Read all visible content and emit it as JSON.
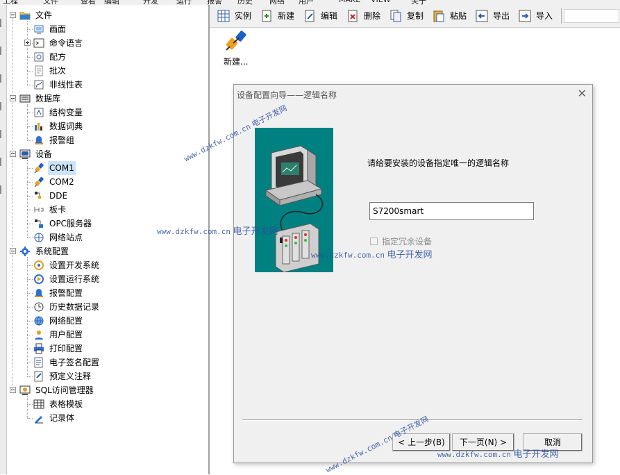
{
  "menu": [
    "工程",
    "文件",
    "查看",
    "编辑",
    "开发",
    "运行",
    "报警",
    "历史",
    "网络",
    "用户",
    "MAKE",
    "VIEW",
    "关于"
  ],
  "tree": {
    "nodes": [
      {
        "id": "file",
        "label": "文件",
        "level": 0,
        "expander": "minus",
        "icon": "folder-icon"
      },
      {
        "id": "screen",
        "label": "画面",
        "level": 1,
        "icon": "screen-icon"
      },
      {
        "id": "cmd",
        "label": "命令语言",
        "level": 1,
        "expander": "plus",
        "icon": "command-icon"
      },
      {
        "id": "recipe",
        "label": "配方",
        "level": 1,
        "icon": "recipe-icon"
      },
      {
        "id": "batch",
        "label": "批次",
        "level": 1,
        "icon": "batch-icon"
      },
      {
        "id": "nonlinear",
        "label": "非线性表",
        "level": 1,
        "icon": "nonlinear-table-icon"
      },
      {
        "id": "db",
        "label": "数据库",
        "level": 0,
        "expander": "minus",
        "icon": "database-icon"
      },
      {
        "id": "struct",
        "label": "结构变量",
        "level": 1,
        "icon": "struct-var-icon"
      },
      {
        "id": "dict",
        "label": "数据词典",
        "level": 1,
        "icon": "data-dictionary-icon"
      },
      {
        "id": "alarmgrp",
        "label": "报警组",
        "level": 1,
        "icon": "alarm-group-icon"
      },
      {
        "id": "device",
        "label": "设备",
        "level": 0,
        "expander": "minus",
        "icon": "device-icon"
      },
      {
        "id": "com1",
        "label": "COM1",
        "level": 1,
        "icon": "plug-icon",
        "selected": true
      },
      {
        "id": "com2",
        "label": "COM2",
        "level": 1,
        "icon": "plug-icon"
      },
      {
        "id": "dde",
        "label": "DDE",
        "level": 1,
        "icon": "dde-icon"
      },
      {
        "id": "board",
        "label": "板卡",
        "level": 1,
        "icon": "board-icon"
      },
      {
        "id": "opc",
        "label": "OPC服务器",
        "level": 1,
        "icon": "opc-icon"
      },
      {
        "id": "netsite",
        "label": "网络站点",
        "level": 1,
        "icon": "network-site-icon"
      },
      {
        "id": "sysconf",
        "label": "系统配置",
        "level": 0,
        "expander": "minus",
        "icon": "gear-icon"
      },
      {
        "id": "devsys",
        "label": "设置开发系统",
        "level": 1,
        "icon": "dev-system-icon"
      },
      {
        "id": "runsys",
        "label": "设置运行系统",
        "level": 1,
        "icon": "run-system-icon"
      },
      {
        "id": "alarmconf",
        "label": "报警配置",
        "level": 1,
        "icon": "alarm-config-icon"
      },
      {
        "id": "history",
        "label": "历史数据记录",
        "level": 1,
        "icon": "history-icon"
      },
      {
        "id": "netconf",
        "label": "网络配置",
        "level": 1,
        "icon": "globe-icon"
      },
      {
        "id": "userconf",
        "label": "用户配置",
        "level": 1,
        "icon": "user-icon"
      },
      {
        "id": "print",
        "label": "打印配置",
        "level": 1,
        "icon": "printer-icon"
      },
      {
        "id": "esign",
        "label": "电子签名配置",
        "level": 1,
        "icon": "signature-icon"
      },
      {
        "id": "note",
        "label": "预定义注释",
        "level": 1,
        "icon": "note-icon"
      },
      {
        "id": "sql",
        "label": "SQL访问管理器",
        "level": 0,
        "expander": "minus",
        "icon": "sql-icon"
      },
      {
        "id": "tpl",
        "label": "表格模板",
        "level": 1,
        "icon": "table-template-icon"
      },
      {
        "id": "rec",
        "label": "记录体",
        "level": 1,
        "icon": "record-icon"
      }
    ]
  },
  "toolbar": [
    {
      "id": "example",
      "label": "实例",
      "icon": "grid-icon"
    },
    {
      "id": "new",
      "label": "新建",
      "icon": "new-icon"
    },
    {
      "id": "edit",
      "label": "编辑",
      "icon": "edit-icon"
    },
    {
      "id": "delete",
      "label": "删除",
      "icon": "delete-icon"
    },
    {
      "id": "copy",
      "label": "复制",
      "icon": "copy-icon"
    },
    {
      "id": "paste",
      "label": "粘贴",
      "icon": "paste-icon"
    },
    {
      "id": "export",
      "label": "导出",
      "icon": "export-icon"
    },
    {
      "id": "import",
      "label": "导入",
      "icon": "import-icon"
    }
  ],
  "content": {
    "new_item_label": "新建..."
  },
  "dialog": {
    "title": "设备配置向导——逻辑名称",
    "prompt": "请给要安装的设备指定唯一的逻辑名称",
    "logical_name": "S7200smart",
    "redundant_label": "指定冗余设备",
    "back_label": "< 上一步(B)",
    "next_label": "下一页(N) >",
    "cancel_label": "取消"
  },
  "watermark": {
    "url": "www.dzkfw.com.cn",
    "name": "电子开发网"
  },
  "colors": {
    "teal": "#008080",
    "selection": "#cce4f7",
    "watermark": "#2a4fa0"
  }
}
